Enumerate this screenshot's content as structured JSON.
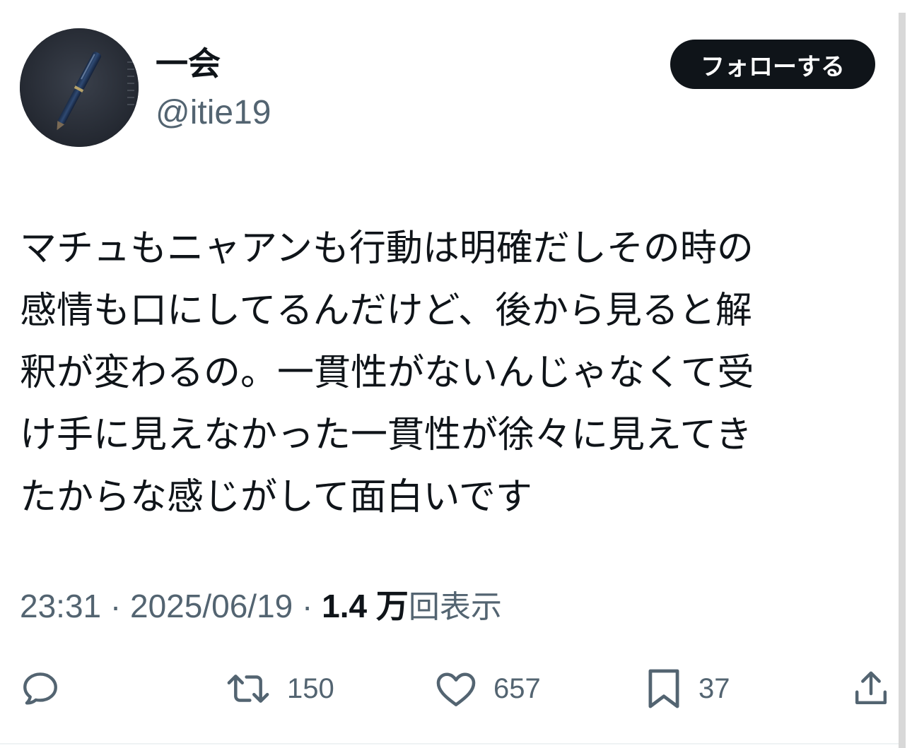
{
  "user": {
    "display_name": "一会",
    "handle": "@itie19"
  },
  "follow_button": {
    "label": "フォローする"
  },
  "tweet": {
    "text": "マチュもニャアンも行動は明確だしその時の\n感情も口にしてるんだけど、後から見ると解\n釈が変わるの。一貫性がないんじゃなくて受\nけ手に見えなかった一貫性が徐々に見えてき\nたからな感じがして面白いです"
  },
  "meta": {
    "time": "23:31",
    "separator": " · ",
    "date": "2025/06/19",
    "views_count": "1.4 万",
    "views_label": "回表示"
  },
  "actions": {
    "reply": {
      "icon": "reply-icon"
    },
    "retweet": {
      "icon": "retweet-icon",
      "count": "150"
    },
    "like": {
      "icon": "heart-icon",
      "count": "657"
    },
    "bookmark": {
      "icon": "bookmark-icon",
      "count": "37"
    },
    "share": {
      "icon": "share-icon"
    }
  },
  "colors": {
    "text_primary": "#0f1419",
    "text_secondary": "#536471",
    "button_bg": "#0f1419",
    "button_text": "#ffffff"
  }
}
